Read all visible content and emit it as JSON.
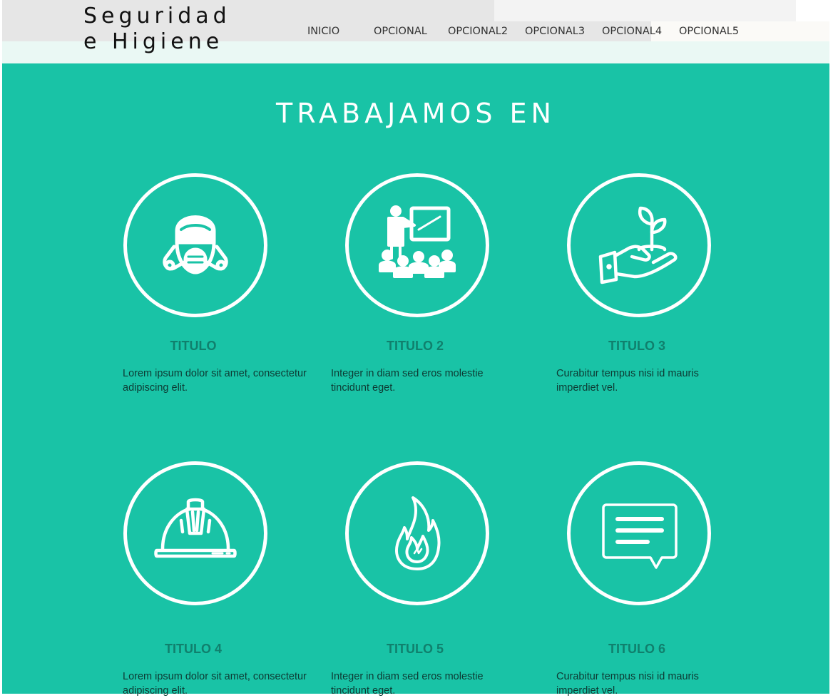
{
  "header": {
    "logo_line1": "Seguridad",
    "logo_line2": "e Higiene",
    "nav": [
      "INICIO",
      "OPCIONAL",
      "OPCIONAL2",
      "OPCIONAL3",
      "OPCIONAL4",
      "OPCIONAL5"
    ]
  },
  "section": {
    "title": "TRABAJAMOS EN",
    "items": [
      {
        "title": "TITULO",
        "text": "Lorem ipsum dolor sit amet, consectetur adipiscing elit.",
        "icon": "gas-mask-icon"
      },
      {
        "title": "TITULO 2",
        "text": "Integer in diam sed eros molestie tincidunt eget.",
        "icon": "training-presentation-icon"
      },
      {
        "title": "TITULO 3",
        "text": "Curabitur tempus nisi id mauris imperdiet vel.",
        "icon": "hand-plant-icon"
      },
      {
        "title": "TITULO 4",
        "text": "Lorem ipsum dolor sit amet, consectetur adipiscing elit.",
        "icon": "hard-hat-icon"
      },
      {
        "title": "TITULO 5",
        "text": "Integer in diam sed eros molestie tincidunt eget.",
        "icon": "fire-icon"
      },
      {
        "title": "TITULO 6",
        "text": "Curabitur tempus nisi id mauris imperdiet vel.",
        "icon": "message-icon"
      }
    ]
  },
  "colors": {
    "accent": "#19c3a6",
    "title_text": "#10806d",
    "body_text": "#0d3a33"
  }
}
